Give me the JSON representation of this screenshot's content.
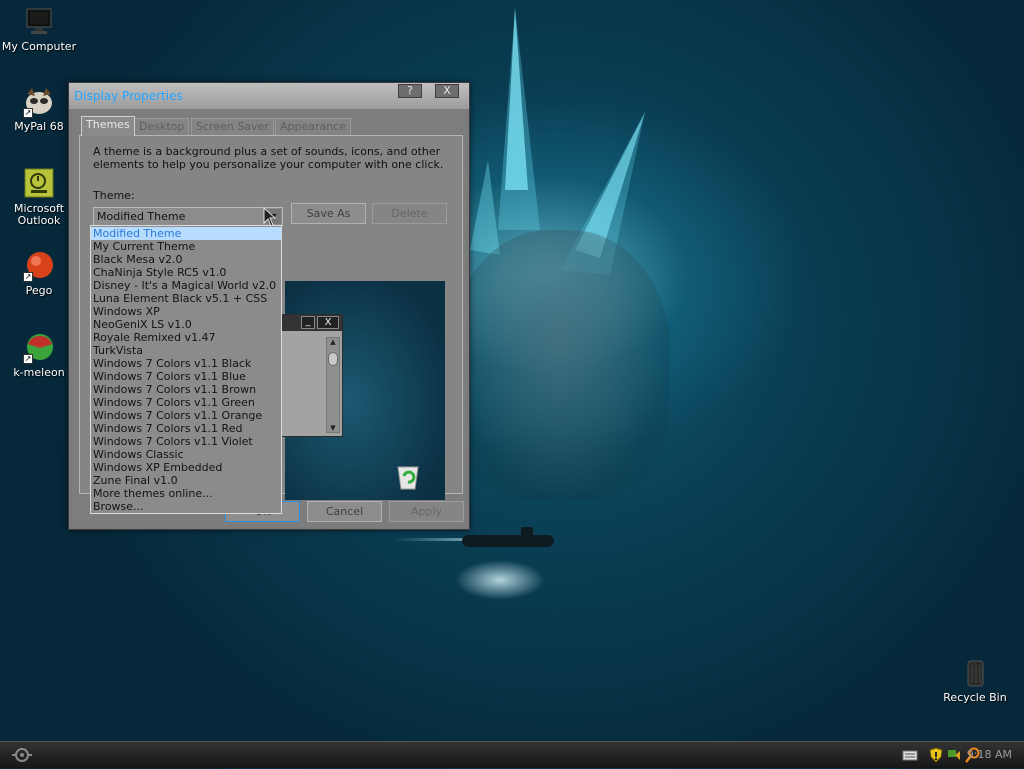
{
  "desktop": {
    "icons": [
      {
        "label": "My Computer",
        "icon": "computer-icon"
      },
      {
        "label": "MyPal 68",
        "icon": "mypal-icon"
      },
      {
        "label": "Microsoft Outlook",
        "icon": "outlook-icon"
      },
      {
        "label": "Pego",
        "icon": "pego-icon"
      },
      {
        "label": "k-meleon",
        "icon": "kmeleon-icon"
      },
      {
        "label": "Recycle Bin",
        "icon": "recycle-bin-icon"
      }
    ]
  },
  "window": {
    "title": "Display Properties",
    "help_glyph": "?",
    "close_glyph": "X",
    "tabs": [
      "Themes",
      "Desktop",
      "Screen Saver",
      "Appearance"
    ],
    "active_tab": "Themes",
    "description": "A theme is a background plus a set of sounds, icons, and other elements to help you personalize your computer with one click.",
    "theme_label": "Theme:",
    "theme_value": "Modified Theme",
    "save_as_label": "Save As",
    "delete_label": "Delete",
    "ok_label": "OK",
    "cancel_label": "Cancel",
    "apply_label": "Apply"
  },
  "theme_options": [
    "Modified Theme",
    "My Current Theme",
    "Black Mesa v2.0",
    "ChaNinja Style RC5 v1.0",
    "Disney - It's a Magical World v2.0",
    "Luna Element Black v5.1 + CSS",
    "Windows XP",
    "NeoGeniX LS v1.0",
    "Royale Remixed v1.47",
    "TurkVista",
    "Windows 7 Colors v1.1 Black",
    "Windows 7 Colors v1.1 Blue",
    "Windows 7 Colors v1.1 Brown",
    "Windows 7 Colors v1.1 Green",
    "Windows 7 Colors v1.1 Orange",
    "Windows 7 Colors v1.1 Red",
    "Windows 7 Colors v1.1 Violet",
    "Windows Classic",
    "Windows XP Embedded",
    "Zune Final v1.0",
    "More themes online...",
    "Browse..."
  ],
  "selected_option": "Modified Theme",
  "preview": {
    "minimize_glyph": "_",
    "close_glyph": "X"
  },
  "taskbar": {
    "clock": "9:18 AM",
    "tray_icons": [
      "keyboard-icon",
      "security-shield-icon",
      "network-icon",
      "search-icon"
    ]
  },
  "colors": {
    "title_text": "#1ea0ff",
    "selection_bg": "#b8dcff",
    "selection_text": "#2a7ad6",
    "window_bg": "#7d7d7d"
  }
}
